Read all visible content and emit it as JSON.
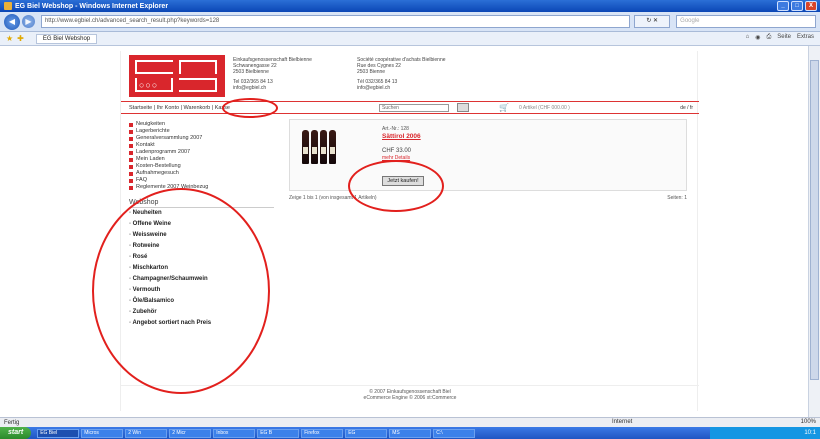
{
  "window": {
    "title": "EG Biel Webshop - Windows Internet Explorer",
    "controls": [
      "_",
      "□",
      "X"
    ]
  },
  "browser": {
    "address": "http://www.egbiel.ch/advanced_search_result.php?keywords=128",
    "go_label": "Google",
    "search_placeholder": "Google",
    "tab_label": "EG Biel Webshop",
    "tools": [
      "Seite",
      "Extras"
    ]
  },
  "site": {
    "company_left": [
      "Einkaufsgenossenschaft Bielbienne",
      "Schwanengasse 22",
      "2503 Bielbienne",
      "Tel 032/365 84 13",
      "info@egbiel.ch"
    ],
    "company_right": [
      "Société coopérative d'achats Bielbienne",
      "Rue des Cygnes 22",
      "2503 Bienne",
      "Tél 032/365 84 13",
      "info@egbiel.ch"
    ],
    "menu": "Startseite | Ihr Konto | Warenkorb | Kasse",
    "search_value": "Suchen",
    "cart_info": "0 Artikel  (CHF 000.00 )",
    "lang": "de / fr",
    "sidebar_links": [
      "Neuigkeiten",
      "Lagerberichte",
      "Generalversammlung 2007",
      "Kontakt",
      "Ladenprogramm 2007",
      "Mein Laden",
      "Kosten-Bestellung",
      "Aufnahmegesuch",
      "FAQ",
      "Reglemente 2007 Weinbezug"
    ],
    "webshop_heading": "Webshop",
    "categories": [
      "Neuheiten",
      "Offene Weine",
      "Weissweine",
      "Rotweine",
      "Rosé",
      "Mischkarton",
      "Champagner/Schaumwein",
      "Vermouth",
      "Öle/Balsamico",
      "Zubehör",
      "Angebot sortiert nach Preis"
    ],
    "product": {
      "art_no": "Art.-Nr.: 128",
      "title": "Sättirol 2006",
      "price": "CHF 33.00",
      "detail_link": "mehr Details",
      "buy_label": "Jetzt kaufen!"
    },
    "pager_left": "Zeige 1 bis 1 (von insgesamt 1 Artikeln)",
    "pager_right": "Seiten: 1",
    "footer": [
      "© 2007 Einkaufsgenossenschaft Biel",
      "eCommerce Engine © 2006 xt:Commerce"
    ]
  },
  "statusbar": {
    "left": "Fertig",
    "zone": "Internet",
    "zoom": "100%"
  },
  "taskbar": {
    "start": "start",
    "tasks": [
      "EG Biel",
      "Micros",
      "2 Win",
      "2 Micr",
      "Inbox",
      "EG B",
      "Firefox",
      "EG",
      "MS",
      "C:\\"
    ],
    "clock": "10:1"
  }
}
